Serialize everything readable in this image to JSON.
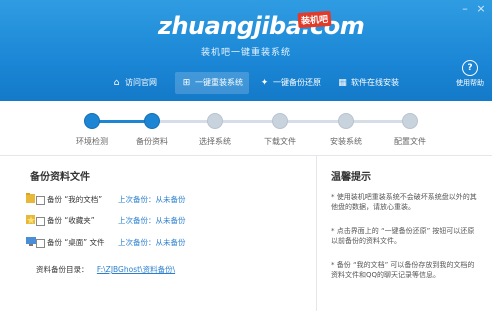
{
  "header": {
    "logo_text": "zhuangjiba.com",
    "logo_badge": "装机吧",
    "subtitle": "装机吧一键重装系统",
    "window_controls": [
      "minimize-icon",
      "close-icon"
    ],
    "nav": [
      {
        "label": "访问官网",
        "icon": "home-icon",
        "active": false
      },
      {
        "label": "一键重装系统",
        "icon": "windows-icon",
        "active": true
      },
      {
        "label": "一键备份还原",
        "icon": "bird-icon",
        "active": false
      },
      {
        "label": "软件在线安装",
        "icon": "grid-icon",
        "active": false
      }
    ],
    "help_label": "使用帮助"
  },
  "steps": {
    "items": [
      "环境检测",
      "备份资料",
      "选择系统",
      "下载文件",
      "安装系统",
      "配置文件"
    ],
    "completed": 2
  },
  "backup": {
    "title": "备份资料文件",
    "rows": [
      {
        "label": "备份 “我的文档”",
        "status": "上次备份：从未备份",
        "icon": "folder-icon"
      },
      {
        "label": "备份 “收藏夹”",
        "status": "上次备份：从未备份",
        "icon": "star-folder-icon"
      },
      {
        "label": "备份 “桌面” 文件",
        "status": "上次备份：从未备份",
        "icon": "desktop-icon"
      }
    ],
    "dir_label": "资料备份目录：",
    "dir_path": "F:\\ZJBGhost\\资料备份\\"
  },
  "tips": {
    "title": "温馨提示",
    "items": [
      "* 使用装机吧重装系统不会破坏系统盘以外的其他盘的数据，请放心重装。",
      "* 点击界面上的 “一键备份还原” 按钮可以还原以前备份的资料文件。",
      "* 备份 “我的文档” 可以备份存放到我的文档的资料文件和QQ的聊天记录等信息。"
    ]
  },
  "colors": {
    "accent": "#1c86d4",
    "link": "#2a7fcf",
    "header": "#1b87d6"
  }
}
